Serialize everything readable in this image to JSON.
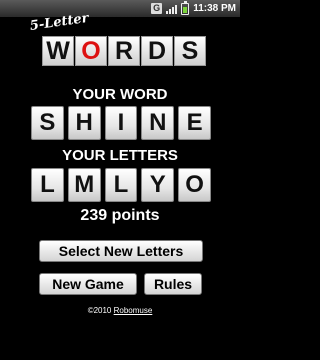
{
  "status_bar": {
    "g_icon_label": "G",
    "time": "11:38 PM",
    "signal_bars": [
      3,
      5,
      7,
      9
    ]
  },
  "logo": {
    "prefix": "5-Letter",
    "letters": [
      "W",
      "O",
      "R",
      "D",
      "S"
    ],
    "highlight_color": "#d11111"
  },
  "your_word": {
    "heading": "YOUR WORD",
    "letters": [
      "S",
      "H",
      "I",
      "N",
      "E"
    ]
  },
  "your_letters": {
    "heading": "YOUR LETTERS",
    "letters": [
      "L",
      "M",
      "L",
      "Y",
      "O"
    ]
  },
  "points": "239 points",
  "buttons": {
    "select_new_letters": "Select New Letters",
    "new_game": "New Game",
    "rules": "Rules"
  },
  "footer": {
    "copyright": "©2010",
    "link": "Robomuse"
  }
}
